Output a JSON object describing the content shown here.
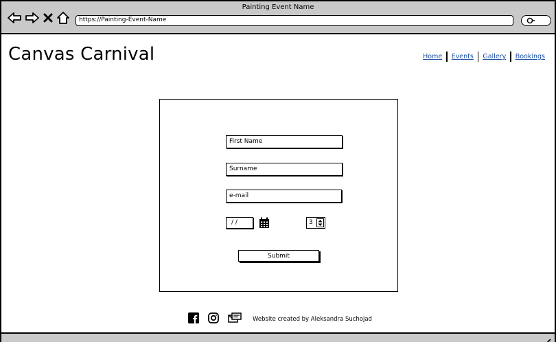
{
  "browser": {
    "window_title": "Painting Event Name",
    "url": "https://Painting-Event-Name",
    "icons": [
      "back-arrow-icon",
      "forward-arrow-icon",
      "close-icon",
      "home-icon",
      "search-icon"
    ]
  },
  "header": {
    "title": "Canvas Carnival",
    "nav": [
      "Home",
      "Events",
      "Gallery",
      "Bookings"
    ],
    "nav_color": "#1a4fa0"
  },
  "form": {
    "first_name_placeholder": "First Name",
    "surname_placeholder": "Surname",
    "email_placeholder": "e-mail",
    "date_value": "/ /",
    "quantity_value": "3",
    "submit_label": "Submit",
    "icons": [
      "calendar-icon",
      "spinner-arrows-icon"
    ]
  },
  "footer": {
    "icons": [
      "facebook-icon",
      "instagram-icon",
      "mail-icon"
    ],
    "credit": "Website created by Aleksandra Suchojad"
  }
}
